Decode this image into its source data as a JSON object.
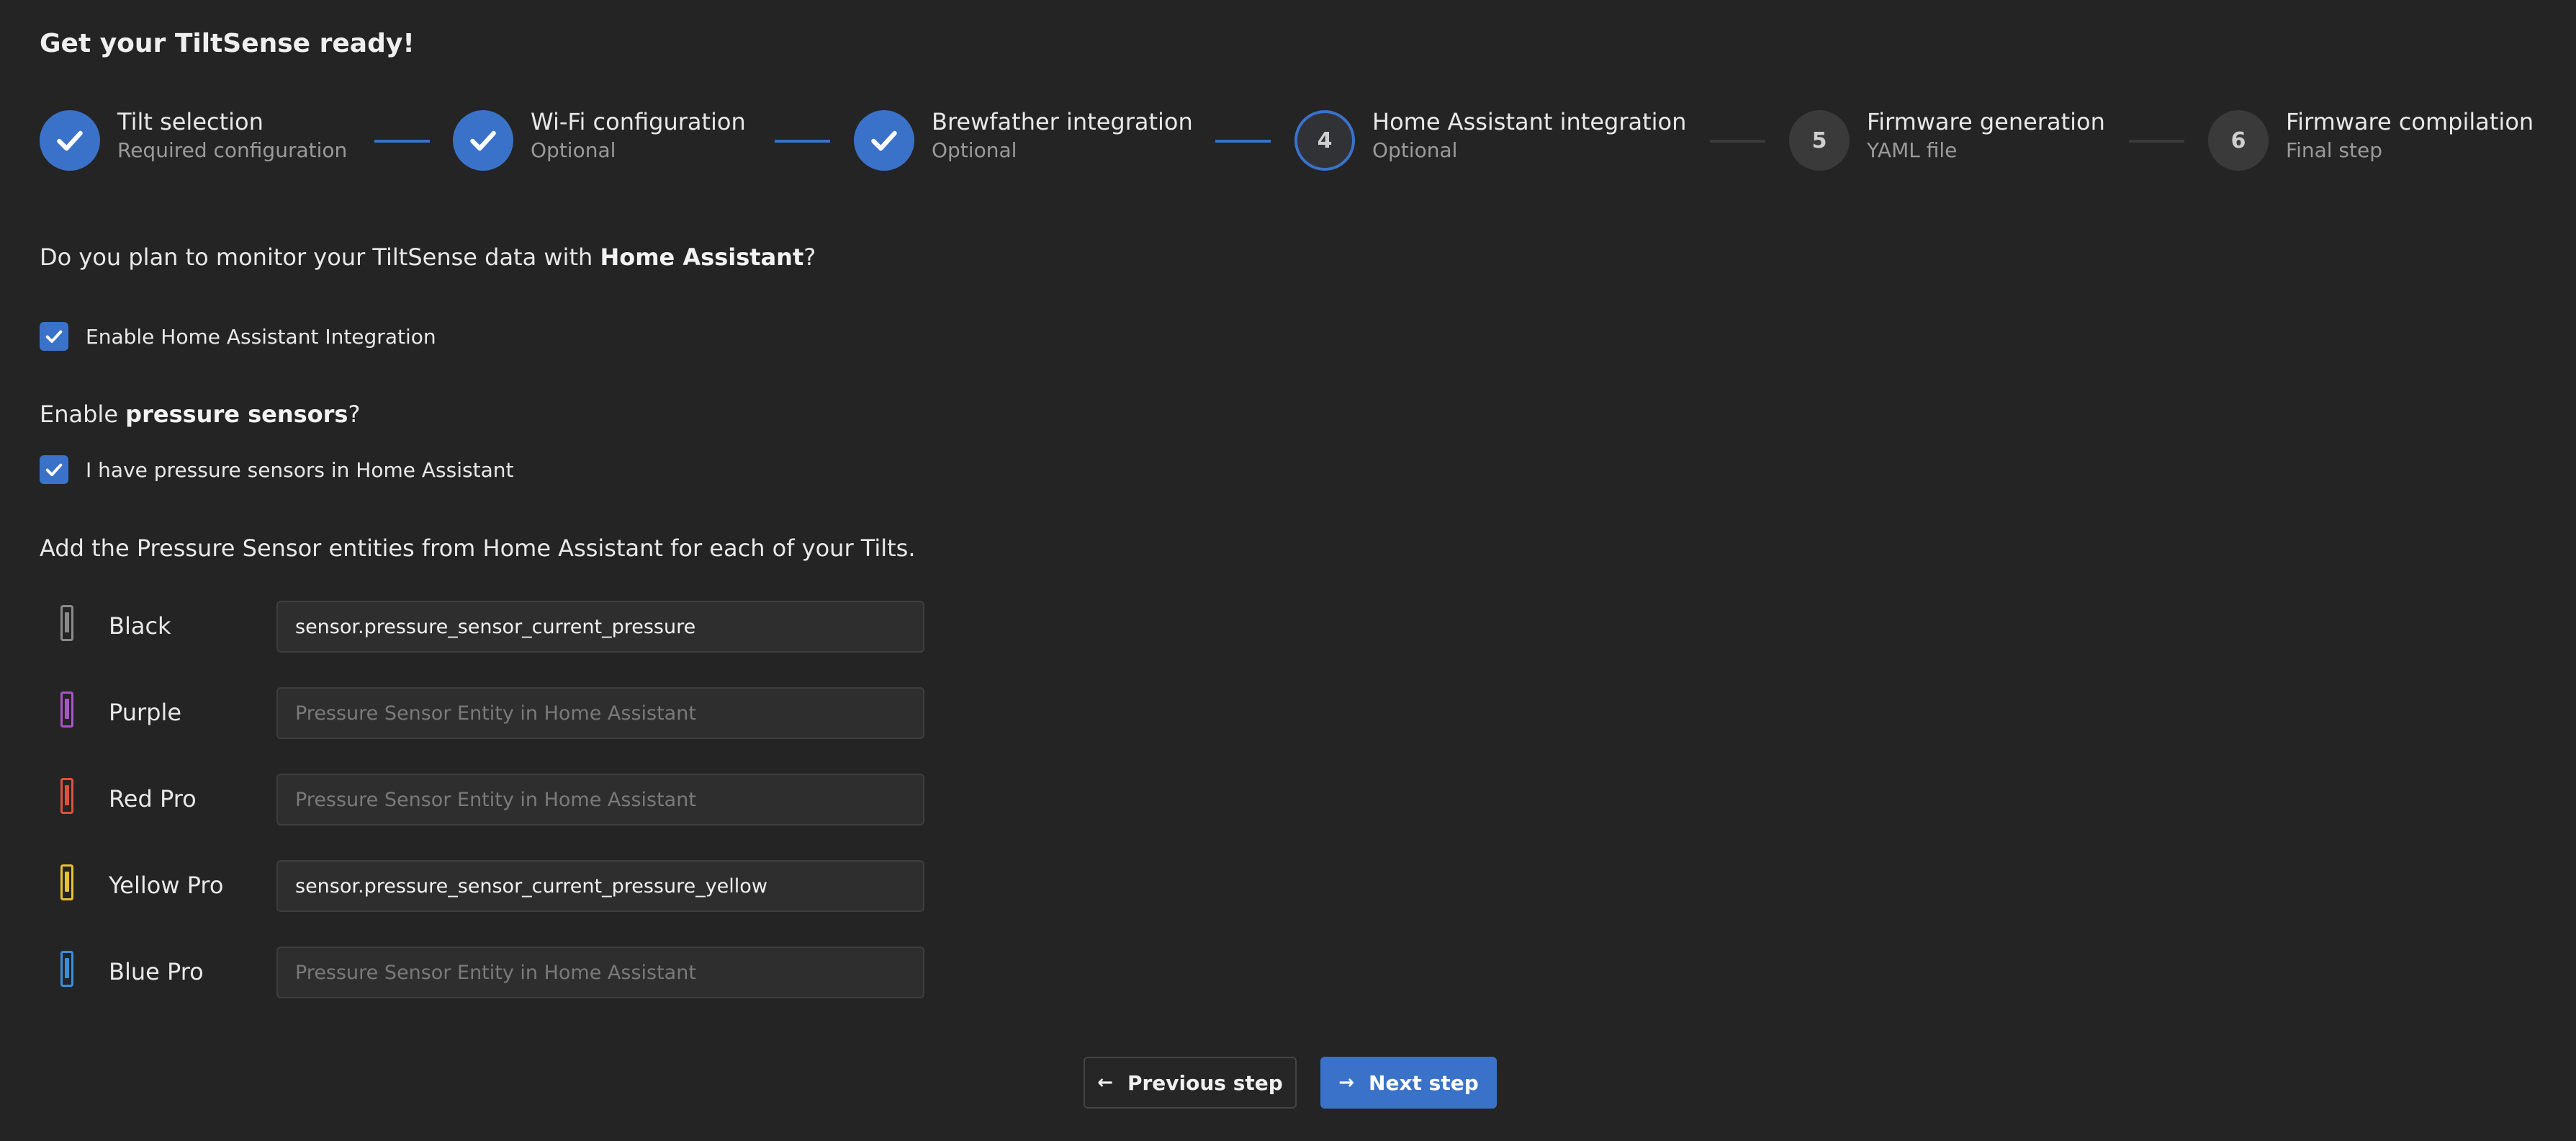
{
  "page": {
    "title": "Get your TiltSense ready!"
  },
  "stepper": {
    "steps": [
      {
        "label": "Tilt selection",
        "desc": "Required configuration",
        "state": "done",
        "number": ""
      },
      {
        "label": "Wi-Fi configuration",
        "desc": "Optional",
        "state": "done",
        "number": ""
      },
      {
        "label": "Brewfather integration",
        "desc": "Optional",
        "state": "done",
        "number": ""
      },
      {
        "label": "Home Assistant integration",
        "desc": "Optional",
        "state": "active",
        "number": "4"
      },
      {
        "label": "Firmware generation",
        "desc": "YAML file",
        "state": "pending",
        "number": "5"
      },
      {
        "label": "Firmware compilation",
        "desc": "Final step",
        "state": "pending",
        "number": "6"
      }
    ]
  },
  "ha_question": {
    "prefix": "Do you plan to monitor your TiltSense data with ",
    "bold": "Home Assistant",
    "suffix": "?"
  },
  "ha_checkbox": {
    "label": "Enable Home Assistant Integration",
    "checked": true
  },
  "pressure_question": {
    "prefix": "Enable ",
    "bold": "pressure sensors",
    "suffix": "?"
  },
  "pressure_checkbox": {
    "label": "I have pressure sensors in Home Assistant",
    "checked": true
  },
  "entities_intro": "Add the Pressure Sensor entities from Home Assistant for each of your Tilts.",
  "tilts": [
    {
      "name": "Black",
      "color": "#8a8a8a",
      "value": "sensor.pressure_sensor_current_pressure",
      "placeholder": "Pressure Sensor Entity in Home Assistant"
    },
    {
      "name": "Purple",
      "color": "#a855c9",
      "value": "",
      "placeholder": "Pressure Sensor Entity in Home Assistant"
    },
    {
      "name": "Red Pro",
      "color": "#e0513a",
      "value": "",
      "placeholder": "Pressure Sensor Entity in Home Assistant"
    },
    {
      "name": "Yellow Pro",
      "color": "#e8c22e",
      "value": "sensor.pressure_sensor_current_pressure_yellow",
      "placeholder": "Pressure Sensor Entity in Home Assistant"
    },
    {
      "name": "Blue Pro",
      "color": "#3a8fdb",
      "value": "",
      "placeholder": "Pressure Sensor Entity in Home Assistant"
    }
  ],
  "buttons": {
    "previous": "Previous step",
    "next": "Next step"
  },
  "colors": {
    "accent": "#3b72c9",
    "background": "#242424"
  }
}
